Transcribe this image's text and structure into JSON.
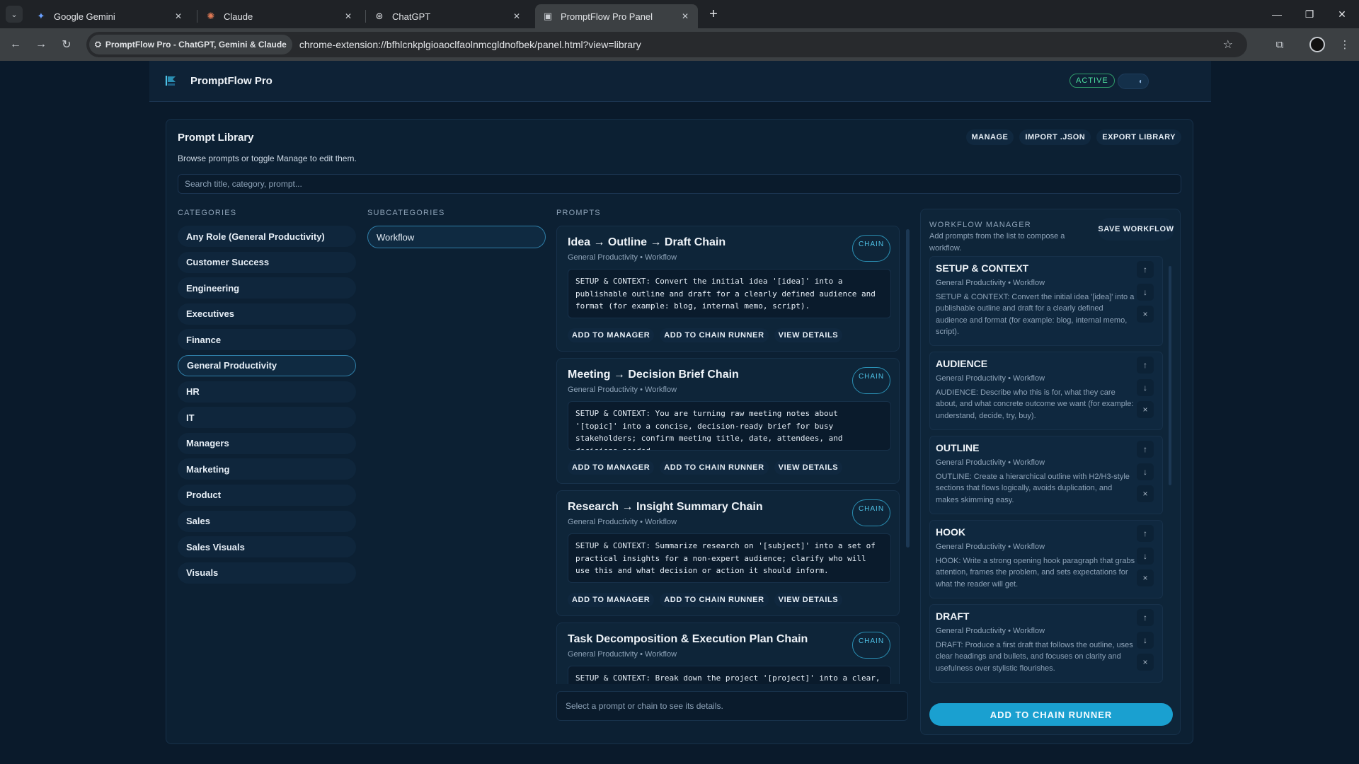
{
  "browser": {
    "tabs": [
      {
        "title": "Google Gemini",
        "icon": "gemini-icon"
      },
      {
        "title": "Claude",
        "icon": "claude-icon"
      },
      {
        "title": "ChatGPT",
        "icon": "chatgpt-icon"
      },
      {
        "title": "PromptFlow Pro Panel",
        "icon": "promptflow-icon",
        "active": true
      }
    ],
    "site_chip": "PromptFlow Pro - ChatGPT, Gemini & Claude",
    "url": "chrome-extension://bfhlcnkplgioaoclfaolnmcgldnofbek/panel.html?view=library"
  },
  "app": {
    "title": "PromptFlow Pro",
    "status": "ACTIVE",
    "colors": {
      "accent": "#1aa0d0",
      "active": "#4ee0a0",
      "background": "#0a1a2b"
    }
  },
  "library": {
    "title": "Prompt Library",
    "subtitle": "Browse prompts or toggle Manage to edit them.",
    "actions": {
      "manage": "MANAGE",
      "import": "IMPORT .JSON",
      "export": "EXPORT LIBRARY"
    },
    "search_placeholder": "Search title, category, prompt...",
    "labels": {
      "categories": "CATEGORIES",
      "subcategories": "SUBCATEGORIES",
      "prompts": "PROMPTS"
    },
    "categories": [
      "Any Role (General Productivity)",
      "Customer Success",
      "Engineering",
      "Executives",
      "Finance",
      "General Productivity",
      "HR",
      "IT",
      "Managers",
      "Marketing",
      "Product",
      "Sales",
      "Sales Visuals",
      "Visuals"
    ],
    "selected_category": "General Productivity",
    "subcategories": [
      "Workflow"
    ],
    "selected_subcategory": "Workflow",
    "prompts": [
      {
        "title": "Idea → Outline → Draft Chain",
        "meta": "General Productivity • Workflow",
        "badge": "CHAIN",
        "body": "SETUP & CONTEXT: Convert the initial idea '[idea]' into a publishable outline and draft for a clearly defined audience and format (for example: blog, internal memo, script)."
      },
      {
        "title": "Meeting → Decision Brief Chain",
        "meta": "General Productivity • Workflow",
        "badge": "CHAIN",
        "body": "SETUP & CONTEXT: You are turning raw meeting notes about '[topic]' into a concise, decision-ready brief for busy stakeholders; confirm meeting title, date, attendees, and decisions needed."
      },
      {
        "title": "Research → Insight Summary Chain",
        "meta": "General Productivity • Workflow",
        "badge": "CHAIN",
        "body": "SETUP & CONTEXT: Summarize research on '[subject]' into a set of practical insights for a non-expert audience; clarify who will use this and what decision or action it should inform."
      },
      {
        "title": "Task Decomposition & Execution Plan Chain",
        "meta": "General Productivity • Workflow",
        "badge": "CHAIN",
        "body": "SETUP & CONTEXT: Break down the project '[project]' into a clear,"
      }
    ],
    "prompt_actions": {
      "add_manager": "ADD TO MANAGER",
      "add_chain": "ADD TO CHAIN RUNNER",
      "view": "VIEW DETAILS"
    },
    "details_placeholder": "Select a prompt or chain to see its details."
  },
  "workflow": {
    "label": "WORKFLOW MANAGER",
    "subtitle": "Add prompts from the list to compose a workflow.",
    "save": "SAVE WORKFLOW",
    "items": [
      {
        "title": "SETUP & CONTEXT",
        "meta": "General Productivity • Workflow",
        "desc": "SETUP & CONTEXT: Convert the initial idea '[idea]' into a publishable outline and draft for a clearly defined audience and format (for example: blog, internal memo, script)."
      },
      {
        "title": "AUDIENCE",
        "meta": "General Productivity • Workflow",
        "desc": "AUDIENCE: Describe who this is for, what they care about, and what concrete outcome we want (for example: understand, decide, try, buy)."
      },
      {
        "title": "OUTLINE",
        "meta": "General Productivity • Workflow",
        "desc": "OUTLINE: Create a hierarchical outline with H2/H3-style sections that flows logically, avoids duplication, and makes skimming easy."
      },
      {
        "title": "HOOK",
        "meta": "General Productivity • Workflow",
        "desc": "HOOK: Write a strong opening hook paragraph that grabs attention, frames the problem, and sets expectations for what the reader will get."
      },
      {
        "title": "DRAFT",
        "meta": "General Productivity • Workflow",
        "desc": "DRAFT: Produce a first draft that follows the outline, uses clear headings and bullets, and focuses on clarity and usefulness over stylistic flourishes."
      }
    ],
    "controls": {
      "up": "↑",
      "down": "↓",
      "remove": "×"
    },
    "run": "ADD TO CHAIN RUNNER"
  }
}
